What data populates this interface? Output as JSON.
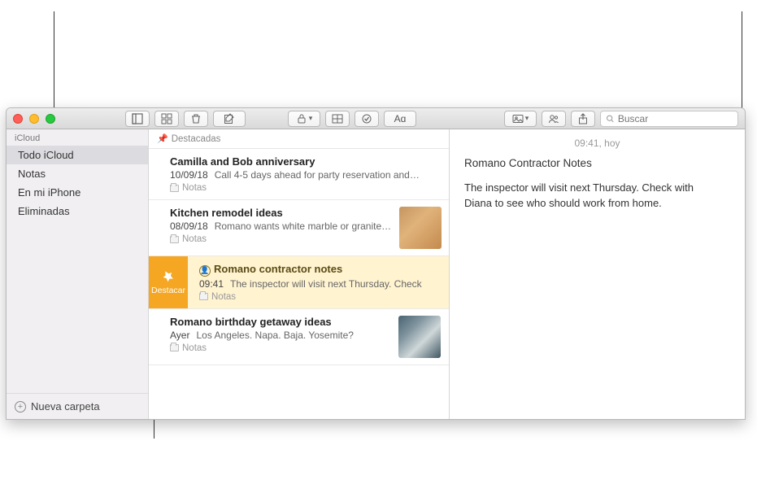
{
  "toolbar": {
    "search_placeholder": "Buscar"
  },
  "sidebar": {
    "account": "iCloud",
    "items": [
      {
        "label": "Todo iCloud",
        "selected": true
      },
      {
        "label": "Notas",
        "selected": false
      },
      {
        "label": "En mi iPhone",
        "selected": false
      },
      {
        "label": "Eliminadas",
        "selected": false
      }
    ],
    "new_folder_label": "Nueva carpeta"
  },
  "list": {
    "section_header": "Destacadas",
    "pin_action_label": "Destacar",
    "notes": [
      {
        "title": "Camilla and Bob anniversary",
        "date": "10/09/18",
        "preview": "Call 4-5 days ahead for party reservation and…",
        "folder": "Notas",
        "thumb": null,
        "selected": false,
        "shared": false
      },
      {
        "title": "Kitchen remodel ideas",
        "date": "08/09/18",
        "preview": "Romano wants white marble or granite…",
        "folder": "Notas",
        "thumb": "wood",
        "selected": false,
        "shared": false
      },
      {
        "title": "Romano contractor notes",
        "date": "09:41",
        "preview": "The inspector will visit next Thursday. Check",
        "folder": "Notas",
        "thumb": null,
        "selected": true,
        "shared": true
      },
      {
        "title": "Romano birthday getaway ideas",
        "date": "Ayer",
        "preview": "Los Angeles. Napa. Baja. Yosemite?",
        "folder": "Notas",
        "thumb": "rock",
        "selected": false,
        "shared": false
      }
    ]
  },
  "editor": {
    "timestamp": "09:41, hoy",
    "title": "Romano Contractor Notes",
    "content": "The inspector will visit next Thursday. Check with Diana to see who should work from home."
  }
}
